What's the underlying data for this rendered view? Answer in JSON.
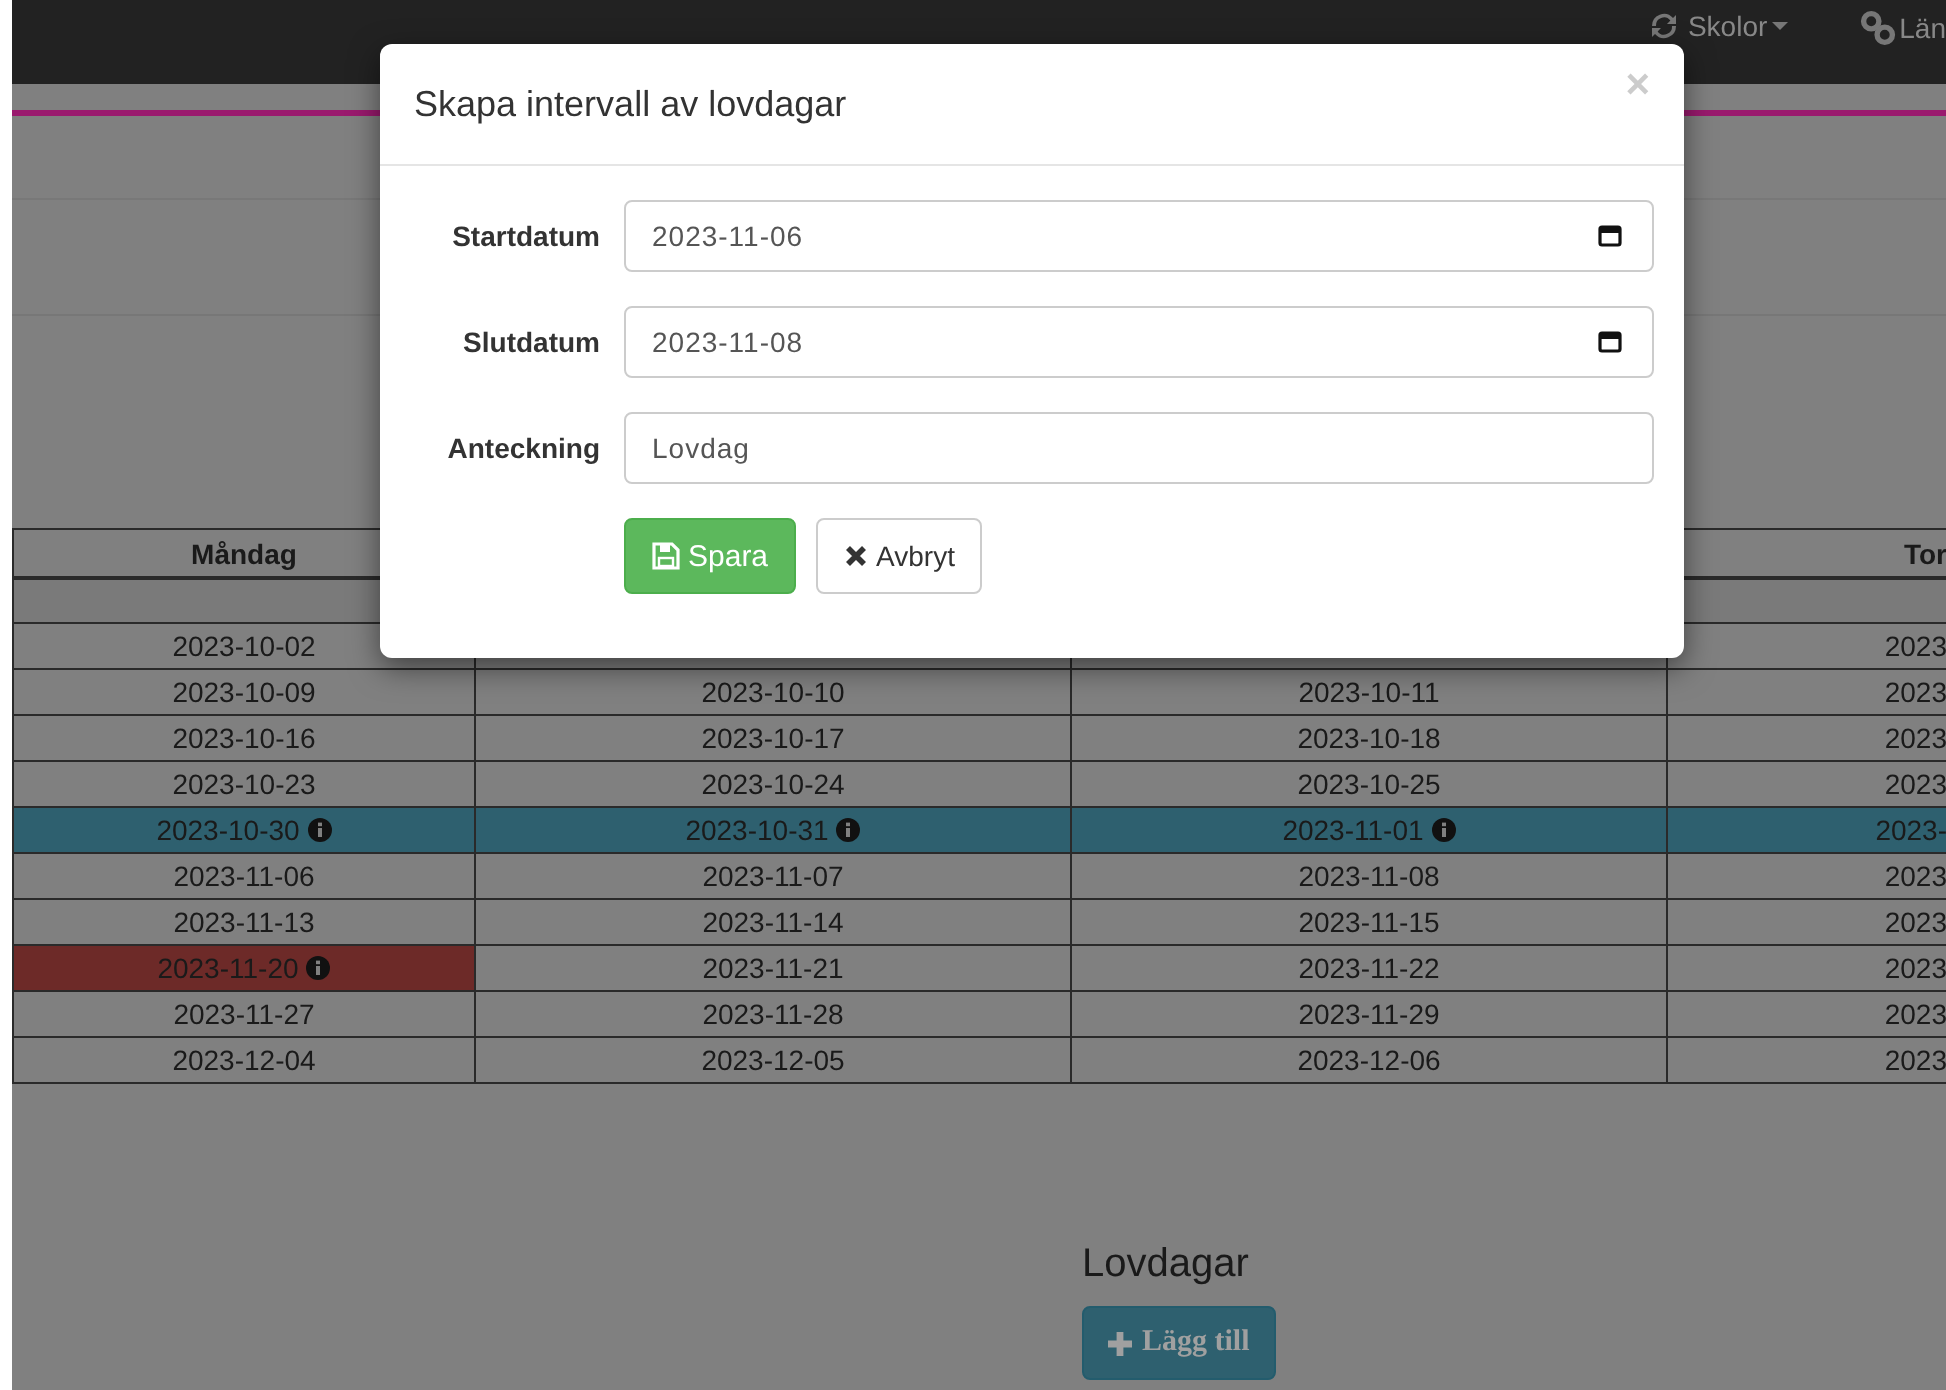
{
  "navbar": {
    "items": [
      {
        "label": "Skolor",
        "dropdown": true
      },
      {
        "label": "Län",
        "dropdown": false
      }
    ]
  },
  "table": {
    "columns": [
      {
        "label": "Måndag"
      },
      {},
      {},
      {
        "label": "Tor"
      }
    ],
    "rows": [
      {
        "kind": "band",
        "cells": [
          {},
          {},
          {},
          {}
        ]
      },
      {
        "kind": "dates",
        "cells": [
          {
            "text": "2023-10-02"
          },
          {},
          {},
          {
            "text": "2023"
          }
        ]
      },
      {
        "kind": "dates",
        "cells": [
          {
            "text": "2023-10-09"
          },
          {
            "text": "2023-10-10"
          },
          {
            "text": "2023-10-11"
          },
          {
            "text": "2023"
          }
        ]
      },
      {
        "kind": "dates",
        "cells": [
          {
            "text": "2023-10-16"
          },
          {
            "text": "2023-10-17"
          },
          {
            "text": "2023-10-18"
          },
          {
            "text": "2023"
          }
        ]
      },
      {
        "kind": "dates",
        "cells": [
          {
            "text": "2023-10-23"
          },
          {
            "text": "2023-10-24"
          },
          {
            "text": "2023-10-25"
          },
          {
            "text": "2023"
          }
        ]
      },
      {
        "kind": "dates",
        "cells": [
          {
            "text": "2023-10-30",
            "color": "#2e606f",
            "info": true
          },
          {
            "text": "2023-10-31",
            "color": "#2e606f",
            "info": true
          },
          {
            "text": "2023-11-01",
            "color": "#2e606f",
            "info": true
          },
          {
            "text": "2023-",
            "color": "#2e606f"
          }
        ]
      },
      {
        "kind": "dates",
        "cells": [
          {
            "text": "2023-11-06"
          },
          {
            "text": "2023-11-07"
          },
          {
            "text": "2023-11-08"
          },
          {
            "text": "2023"
          }
        ]
      },
      {
        "kind": "dates",
        "cells": [
          {
            "text": "2023-11-13"
          },
          {
            "text": "2023-11-14"
          },
          {
            "text": "2023-11-15"
          },
          {
            "text": "2023"
          }
        ]
      },
      {
        "kind": "dates",
        "cells": [
          {
            "text": "2023-11-20",
            "color": "#6d2a28",
            "info": true
          },
          {
            "text": "2023-11-21"
          },
          {
            "text": "2023-11-22"
          },
          {
            "text": "2023"
          }
        ]
      },
      {
        "kind": "dates",
        "cells": [
          {
            "text": "2023-11-27"
          },
          {
            "text": "2023-11-28"
          },
          {
            "text": "2023-11-29"
          },
          {
            "text": "2023"
          }
        ]
      },
      {
        "kind": "dates",
        "cells": [
          {
            "text": "2023-12-04"
          },
          {
            "text": "2023-12-05"
          },
          {
            "text": "2023-12-06"
          },
          {
            "text": "2023"
          }
        ]
      }
    ]
  },
  "section": {
    "title": "Lovdagar",
    "button": "Lägg till"
  },
  "modal": {
    "title": "Skapa intervall av lovdagar",
    "close": "×",
    "fields": [
      {
        "label": "Startdatum",
        "kind": "date",
        "value": "2023-11-06"
      },
      {
        "label": "Slutdatum",
        "kind": "date",
        "value": "2023-11-08"
      },
      {
        "label": "Anteckning",
        "kind": "text",
        "value": "Lovdag"
      }
    ],
    "buttons": [
      {
        "label": "Spara",
        "kind": "primary"
      },
      {
        "label": "Avbryt",
        "kind": "default"
      }
    ]
  }
}
